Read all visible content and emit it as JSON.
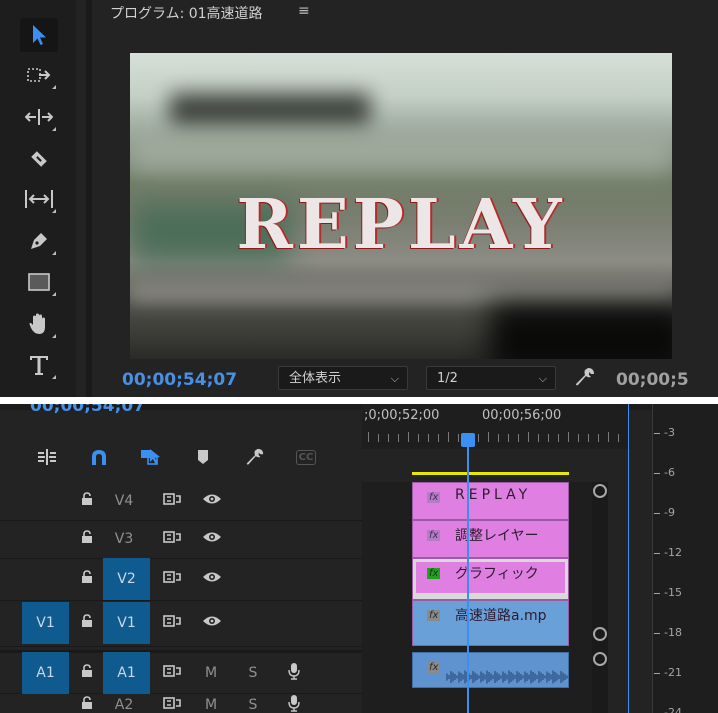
{
  "monitor": {
    "title": "プログラム: 01高速道路",
    "menu_icon": "≡",
    "title_text": "REPLAY",
    "timecode_current": "00;00;54;07",
    "zoom_select": "全体表示",
    "resolution_select": "1/2",
    "timecode_duration": "00;00;5"
  },
  "tools": [
    "selection-tool",
    "track-select-forward-tool",
    "ripple-edit-tool",
    "razor-tool",
    "slip-tool",
    "pen-tool",
    "rectangle-tool",
    "hand-tool",
    "type-tool"
  ],
  "timeline": {
    "timecode": "00;00;54;07",
    "ruler_labels": [
      ";0;00;52;00",
      "00;00;56;00"
    ],
    "toolbar": [
      "insert-and-overwrite-sequences-icon",
      "snap-magnet-icon",
      "linked-selection-icon",
      "add-marker-icon",
      "timeline-settings-wrench-icon",
      "captions-cc-icon"
    ],
    "captions_label": "CC",
    "tracks": [
      {
        "name": "V4",
        "source": "",
        "target": false
      },
      {
        "name": "V3",
        "source": "",
        "target": false
      },
      {
        "name": "V2",
        "source": "",
        "target": true
      },
      {
        "name": "V1",
        "source": "V1",
        "target": true
      },
      {
        "name": "A1",
        "source": "A1",
        "target": true
      },
      {
        "name": "A2",
        "source": "",
        "target": false
      }
    ],
    "mute_label": "M",
    "solo_label": "S",
    "clips": [
      {
        "fx": "fx",
        "label": "REPLAY"
      },
      {
        "fx": "fx",
        "label": "調整レイヤー"
      },
      {
        "fx": "fx",
        "label": "グラフィック"
      },
      {
        "fx": "fx",
        "label": "高速道路a.mp"
      }
    ]
  },
  "meter": {
    "labels": [
      "-3",
      "-6",
      "-9",
      "-12",
      "-15",
      "-18",
      "-21",
      "-24"
    ]
  },
  "colors": {
    "accent_blue": "#3b8ff0",
    "timecode_blue": "#4a90e2",
    "clip_pink": "#e07fe2",
    "clip_blue": "#6aa0d8",
    "yellow_bar": "#e8e800"
  }
}
